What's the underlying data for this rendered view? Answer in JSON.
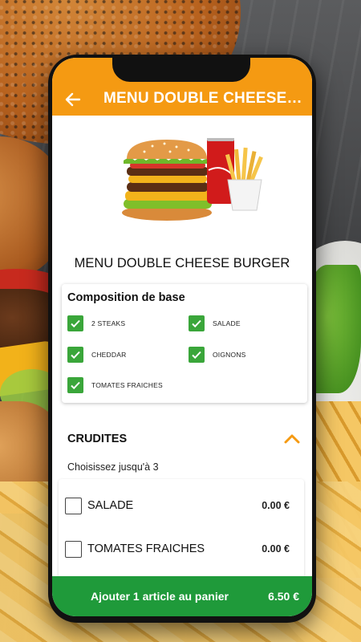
{
  "header": {
    "title": "MENU DOUBLE CHEESE BURGER",
    "accent_color": "#f59a12"
  },
  "product": {
    "name": "MENU DOUBLE CHEESE BURGER",
    "image_icons": [
      "burger-icon",
      "soda-can-icon",
      "fries-icon"
    ]
  },
  "composition": {
    "title": "Composition de base",
    "items": [
      {
        "label": "2 STEAKS",
        "checked": true
      },
      {
        "label": "SALADE",
        "checked": true
      },
      {
        "label": "CHEDDAR",
        "checked": true
      },
      {
        "label": "OIGNONS",
        "checked": true
      },
      {
        "label": "TOMATES FRAICHES",
        "checked": true
      }
    ],
    "check_color": "#3aa63a"
  },
  "crudites": {
    "title": "CRUDITES",
    "hint": "Choisissez jusqu'à 3",
    "options": [
      {
        "name": "SALADE",
        "price": "0.00 €",
        "checked": false
      },
      {
        "name": "TOMATES FRAICHES",
        "price": "0.00 €",
        "checked": false
      }
    ]
  },
  "cart": {
    "label": "Ajouter 1 article au panier",
    "price": "6.50 €",
    "color": "#1f9a3a"
  }
}
